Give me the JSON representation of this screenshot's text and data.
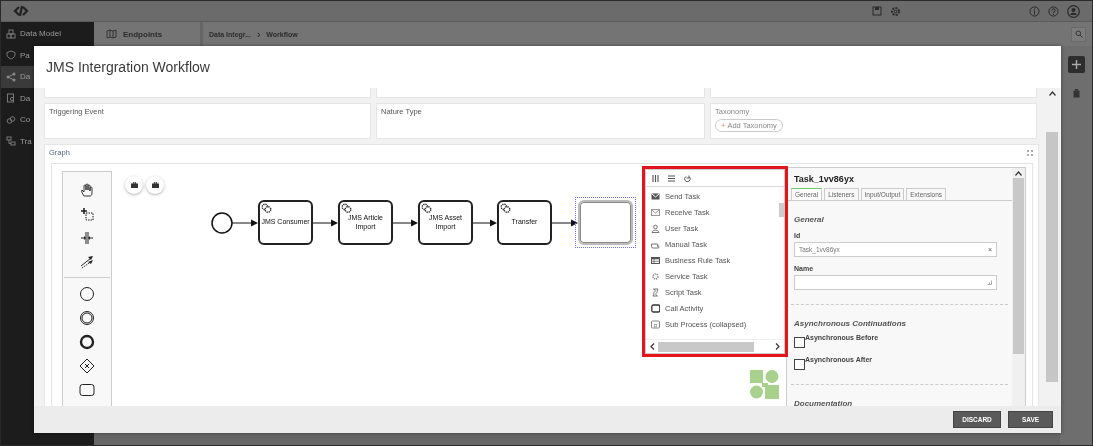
{
  "sidebar": {
    "items": [
      {
        "label": "Data Model",
        "selected": false
      },
      {
        "label": "Pa",
        "selected": false
      },
      {
        "label": "Da",
        "selected": true
      },
      {
        "label": "Da",
        "selected": false
      },
      {
        "label": "Co",
        "selected": false
      },
      {
        "label": "Tra",
        "selected": false
      }
    ]
  },
  "panel": {
    "title": "Endpoints"
  },
  "breadcrumb": {
    "items": [
      "Data Integr...",
      "Workflow"
    ],
    "separator": "›"
  },
  "modal": {
    "title": "JMS Intergration Workflow",
    "fields": [
      {
        "label": "Triggering Event"
      },
      {
        "label": "Nature Type"
      },
      {
        "label": "Taxonomy",
        "muted": true,
        "add_button": {
          "icon": "+",
          "label": "Add Taxonomy"
        }
      }
    ],
    "graph": {
      "label": "Graph",
      "nodes": [
        {
          "kind": "start_event",
          "selected": false
        },
        {
          "kind": "service_task",
          "label": "JMS Consumer",
          "selected": false
        },
        {
          "kind": "service_task",
          "label": "JMS Article Import",
          "selected": false
        },
        {
          "kind": "service_task",
          "label": "JMS Asset Import",
          "selected": false
        },
        {
          "kind": "service_task",
          "label": "Transfer",
          "selected": false
        },
        {
          "kind": "task",
          "selected": true
        }
      ],
      "popup": {
        "items": [
          {
            "kind": "send",
            "label": "Send Task"
          },
          {
            "kind": "receive",
            "label": "Receive Task"
          },
          {
            "kind": "user",
            "label": "User Task"
          },
          {
            "kind": "manual",
            "label": "Manual Task"
          },
          {
            "kind": "rule",
            "label": "Business Rule Task"
          },
          {
            "kind": "service",
            "label": "Service Task"
          },
          {
            "kind": "script",
            "label": "Script Task"
          },
          {
            "kind": "call",
            "label": "Call Activity"
          },
          {
            "kind": "subprocess",
            "label": "Sub Process (collapsed)"
          }
        ]
      },
      "properties": {
        "title": "Task_1vv86yx",
        "tabs": [
          {
            "label": "General",
            "selected": true
          },
          {
            "label": "Listeners",
            "selected": false
          },
          {
            "label": "Input/Output",
            "selected": false
          },
          {
            "label": "Extensions",
            "selected": false
          }
        ],
        "section": "General",
        "id_field": {
          "label": "Id",
          "value": "Task_1vv86yx",
          "clear": "×"
        },
        "name_field": {
          "label": "Name"
        },
        "async_section": "Asynchronous Continuations",
        "checkboxes": [
          {
            "label": "Asynchronous Before",
            "checked": false
          },
          {
            "label": "Asynchronous After",
            "checked": false
          }
        ],
        "doc_section": "Documentation"
      }
    }
  },
  "footer_buttons": [
    "DISCARD",
    "SAVE"
  ]
}
